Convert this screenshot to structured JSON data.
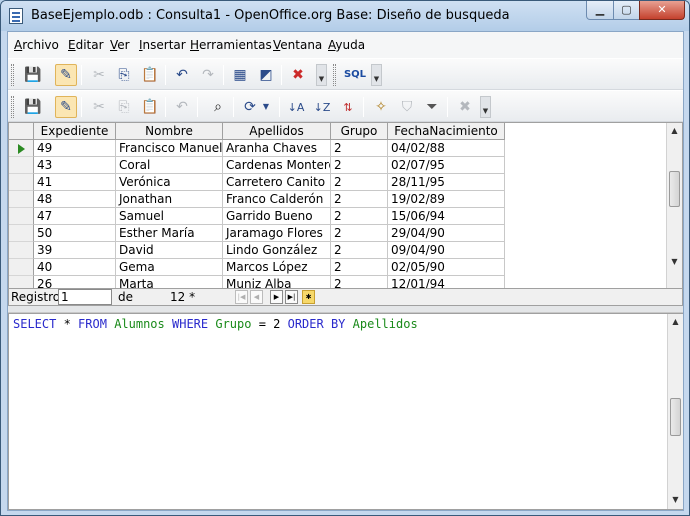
{
  "window": {
    "title": "BaseEjemplo.odb : Consulta1 - OpenOffice.org Base: Diseño de busqueda",
    "minimize": "▁",
    "maximize": "▢",
    "close": "✕"
  },
  "menu": [
    "Archivo",
    "Editar",
    "Ver",
    "Insertar",
    "Herramientas",
    "Ventana",
    "Ayuda"
  ],
  "toolbar1": {
    "sql_label": "SQL"
  },
  "grid": {
    "columns": [
      "Expediente",
      "Nombre",
      "Apellidos",
      "Grupo",
      "FechaNacimiento"
    ],
    "rows": [
      [
        "49",
        "Francisco Manuel",
        "Aranha Chaves",
        "2",
        "04/02/88"
      ],
      [
        "43",
        "Coral",
        "Cardenas Montero",
        "2",
        "02/07/95"
      ],
      [
        "41",
        "Verónica",
        "Carretero Canito",
        "2",
        "28/11/95"
      ],
      [
        "48",
        "Jonathan",
        "Franco Calderón",
        "2",
        "19/02/89"
      ],
      [
        "47",
        "Samuel",
        "Garrido Bueno",
        "2",
        "15/06/94"
      ],
      [
        "50",
        "Esther María",
        "Jaramago Flores",
        "2",
        "29/04/90"
      ],
      [
        "39",
        "David",
        "Lindo González",
        "2",
        "09/04/90"
      ],
      [
        "40",
        "Gema",
        "Marcos López",
        "2",
        "02/05/90"
      ],
      [
        "26",
        "Marta",
        "Muniz Alba",
        "2",
        "12/01/94"
      ]
    ]
  },
  "navigator": {
    "record_label": "Registro",
    "record_value": "1",
    "of_label": "de",
    "count": "12 *"
  },
  "sql": {
    "tokens": [
      {
        "text": "SELECT",
        "kind": "kw"
      },
      {
        "text": " * ",
        "kind": "op"
      },
      {
        "text": "FROM",
        "kind": "kw"
      },
      {
        "text": " ",
        "kind": "op"
      },
      {
        "text": "Alumnos",
        "kind": "fld"
      },
      {
        "text": " ",
        "kind": "op"
      },
      {
        "text": "WHERE",
        "kind": "kw"
      },
      {
        "text": " ",
        "kind": "op"
      },
      {
        "text": "Grupo",
        "kind": "fld"
      },
      {
        "text": " = 2 ",
        "kind": "op"
      },
      {
        "text": "ORDER BY",
        "kind": "kw"
      },
      {
        "text": " ",
        "kind": "op"
      },
      {
        "text": "Apellidos",
        "kind": "fld"
      }
    ]
  },
  "colors": {
    "keyword": "#2a2acc",
    "field": "#1a8a1a",
    "current_row_arrow": "#2b8a22"
  }
}
